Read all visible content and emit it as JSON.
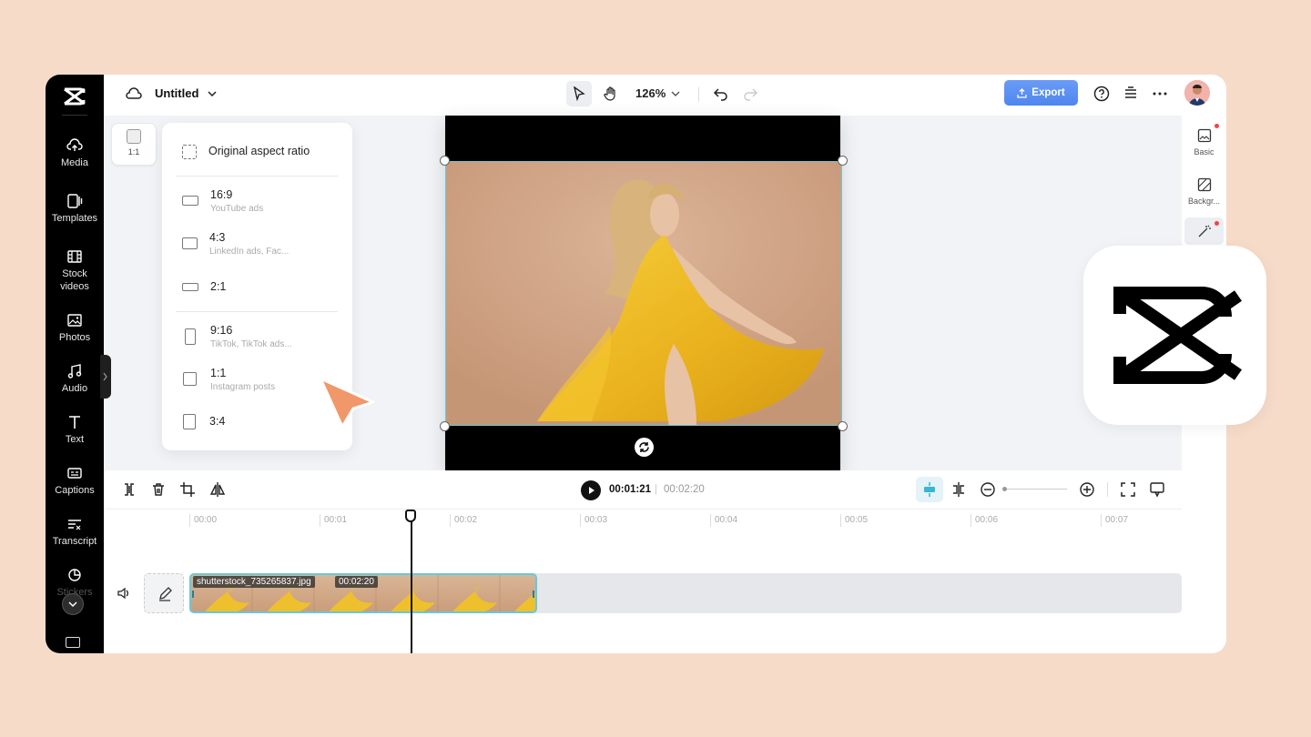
{
  "app": {
    "title": "Untitled",
    "zoom": "126%",
    "export_label": "Export"
  },
  "rail": {
    "items": [
      {
        "label": "Media",
        "icon": "cloud-upload-icon"
      },
      {
        "label": "Templates",
        "icon": "templates-icon"
      },
      {
        "label": "Stock videos",
        "icon": "film-icon"
      },
      {
        "label": "Photos",
        "icon": "image-icon"
      },
      {
        "label": "Audio",
        "icon": "music-note-icon"
      },
      {
        "label": "Text",
        "icon": "text-icon"
      },
      {
        "label": "Captions",
        "icon": "captions-icon"
      },
      {
        "label": "Transcript",
        "icon": "transcript-icon"
      },
      {
        "label": "Stickers",
        "icon": "sticker-icon"
      }
    ]
  },
  "right_panel": {
    "items": [
      {
        "label": "Basic",
        "icon": "image-icon"
      },
      {
        "label": "Backgr...",
        "icon": "background-icon"
      },
      {
        "label": "",
        "icon": "magic-wand-icon"
      }
    ]
  },
  "ratio_button": {
    "label": "1:1"
  },
  "aspect_menu": {
    "original": "Original aspect ratio",
    "options": [
      {
        "ratio": "16:9",
        "desc": "YouTube ads"
      },
      {
        "ratio": "4:3",
        "desc": "LinkedIn ads, Fac..."
      },
      {
        "ratio": "2:1",
        "desc": ""
      },
      {
        "ratio": "9:16",
        "desc": "TikTok, TikTok ads..."
      },
      {
        "ratio": "1:1",
        "desc": "Instagram posts"
      },
      {
        "ratio": "3:4",
        "desc": ""
      }
    ]
  },
  "timeline": {
    "current_time": "00:01:21",
    "separator": "|",
    "total_time": "00:02:20",
    "ticks": [
      "00:00",
      "00:01",
      "00:02",
      "00:03",
      "00:04",
      "00:05",
      "00:06",
      "00:07"
    ],
    "clip": {
      "filename": "shutterstock_735265837.jpg",
      "duration": "00:02:20"
    }
  },
  "colors": {
    "background": "#f7dbc9",
    "accent": "#5b8ff9",
    "selection": "#67c9d8",
    "pointer": "#f0986a"
  }
}
